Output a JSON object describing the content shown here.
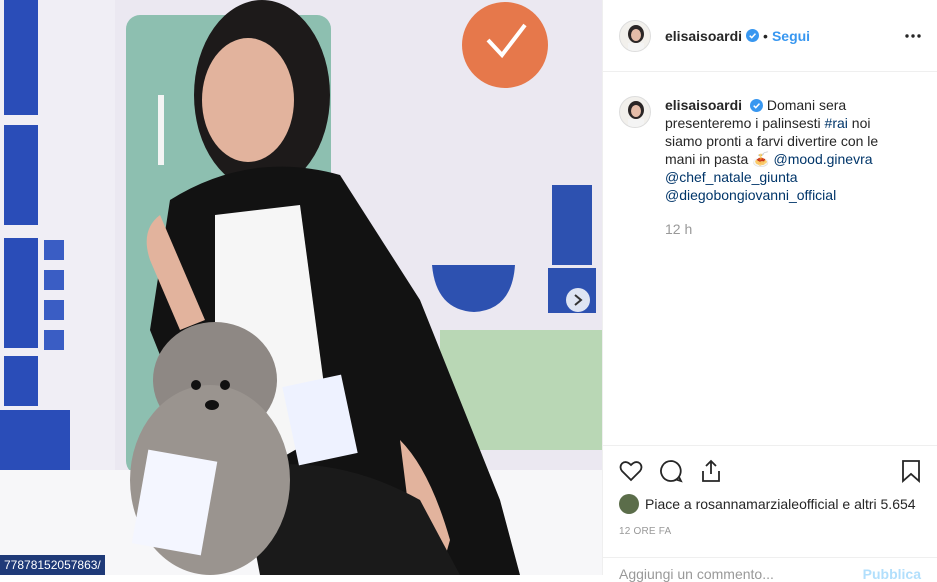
{
  "post": {
    "username": "elisaisoardi",
    "follow_label": "Segui",
    "dot": "•",
    "caption_parts": {
      "text1": "Domani sera presenteremo i palinsesti ",
      "hashtag": "#rai",
      "text2": " noi siamo pronti a farvi divertire con le mani in pasta ",
      "emoji": "🍝",
      "mention1": "@mood.ginevra",
      "mention2": "@chef_natale_giunta",
      "mention3": "@diegobongiovanni_official"
    },
    "time": "12 h",
    "likes_text": "Piace a rosannamarzialeofficial e altri 5.654",
    "time_ago": "12 ORE FA",
    "comment_placeholder": "Aggiungi un commento...",
    "publish_label": "Pubblica"
  },
  "media": {
    "status_url": "77878152057863/"
  },
  "colors": {
    "accent": "#3897f0",
    "link": "#003569",
    "verified": "#3897f0"
  },
  "icons": [
    "verified-badge-icon",
    "more-options-icon",
    "heart-icon",
    "comment-icon",
    "share-icon",
    "bookmark-icon",
    "next-arrow-icon"
  ]
}
